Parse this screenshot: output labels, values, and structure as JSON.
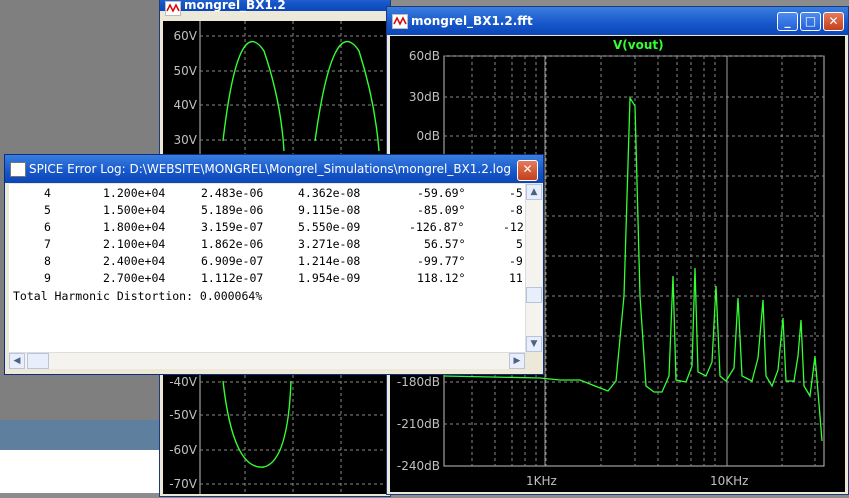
{
  "wave_window": {
    "title": "mongrel_BX1.2",
    "y_ticks": [
      "60V",
      "50V",
      "40V",
      "30V",
      "-40V",
      "-50V",
      "-60V",
      "-70V"
    ]
  },
  "fft_window": {
    "title": "mongrel_BX1.2.fft",
    "trace_label": "V(vout)",
    "y_ticks": [
      "60dB",
      "30dB",
      "0dB",
      "-180dB",
      "-210dB",
      "-240dB"
    ],
    "x_ticks": [
      "1KHz",
      "10KHz"
    ],
    "buttons": {
      "minimize": "_",
      "maximize": "□",
      "close": "✕"
    }
  },
  "log_window": {
    "title": "SPICE Error Log: D:\\WEBSITE\\MONGREL\\Mongrel_Simulations\\mongrel_BX1.2.log",
    "rows": [
      {
        "n": "4",
        "freq": "1.200e+04",
        "fourier": "2.483e-06",
        "norm": "4.362e-08",
        "phase": "-59.69°",
        "norm_phase": "-5"
      },
      {
        "n": "5",
        "freq": "1.500e+04",
        "fourier": "5.189e-06",
        "norm": "9.115e-08",
        "phase": "-85.09°",
        "norm_phase": "-8"
      },
      {
        "n": "6",
        "freq": "1.800e+04",
        "fourier": "3.159e-07",
        "norm": "5.550e-09",
        "phase": "-126.87°",
        "norm_phase": "-12"
      },
      {
        "n": "7",
        "freq": "2.100e+04",
        "fourier": "1.862e-06",
        "norm": "3.271e-08",
        "phase": "56.57°",
        "norm_phase": "5"
      },
      {
        "n": "8",
        "freq": "2.400e+04",
        "fourier": "6.909e-07",
        "norm": "1.214e-08",
        "phase": "-99.77°",
        "norm_phase": "-9"
      },
      {
        "n": "9",
        "freq": "2.700e+04",
        "fourier": "1.112e-07",
        "norm": "1.954e-09",
        "phase": "118.12°",
        "norm_phase": "11"
      }
    ],
    "thd": "Total Harmonic Distortion: 0.000064%"
  },
  "colors": {
    "trace": "#33ff33",
    "grid": "#8a8a8a",
    "title_bar": "#1656c9"
  }
}
